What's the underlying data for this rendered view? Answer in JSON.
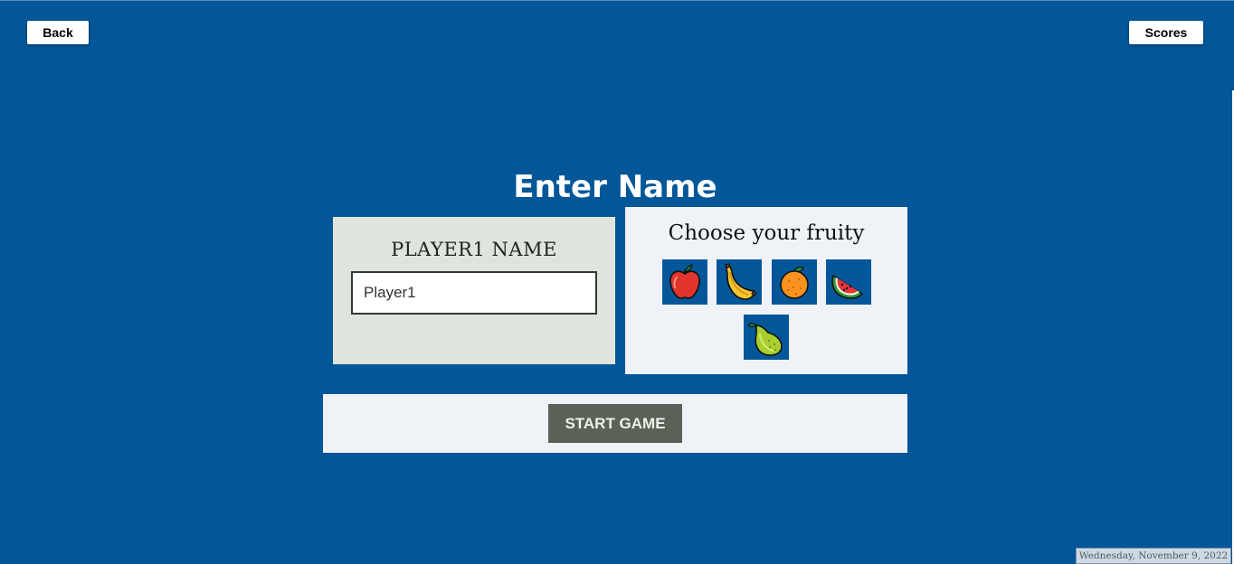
{
  "nav": {
    "back_label": "Back",
    "scores_label": "Scores"
  },
  "title": "Enter Name",
  "player": {
    "label": "PLAYER1 NAME",
    "name_value": "Player1"
  },
  "fruit_picker": {
    "label": "Choose your fruity",
    "fruits": [
      "apple",
      "banana",
      "orange",
      "watermelon",
      "pear"
    ]
  },
  "start_button_label": "START GAME",
  "date_text": "Wednesday, November 9, 2022",
  "colors": {
    "background": "#035799",
    "player_panel": "#dfe5dd",
    "fruit_panel": "#eff3f7",
    "start_button": "#5c6158"
  }
}
